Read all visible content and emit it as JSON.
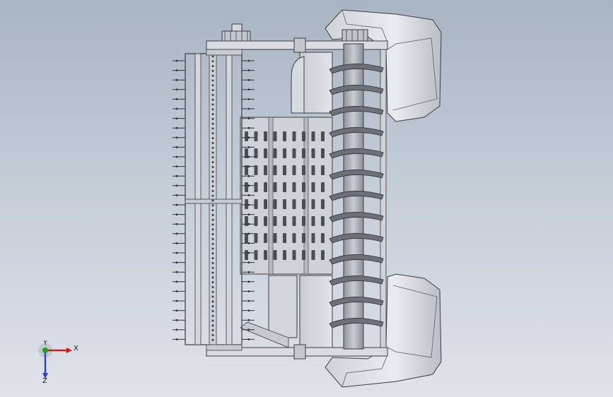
{
  "viewport": {
    "background_top": "#a9b4c3",
    "background_bottom": "#dfe3e9"
  },
  "model": {
    "kind": "combine-harvester-header",
    "parts": [
      "auger",
      "cutter-bar",
      "reel-tines",
      "feeder-house-grate",
      "side-shields",
      "drive-pulleys"
    ]
  },
  "triad": {
    "x_label": "X",
    "y_label": "Y",
    "z_label": "Z",
    "x_color": "#c62020",
    "y_color": "#1fa31f",
    "z_color": "#2a3fc2"
  }
}
